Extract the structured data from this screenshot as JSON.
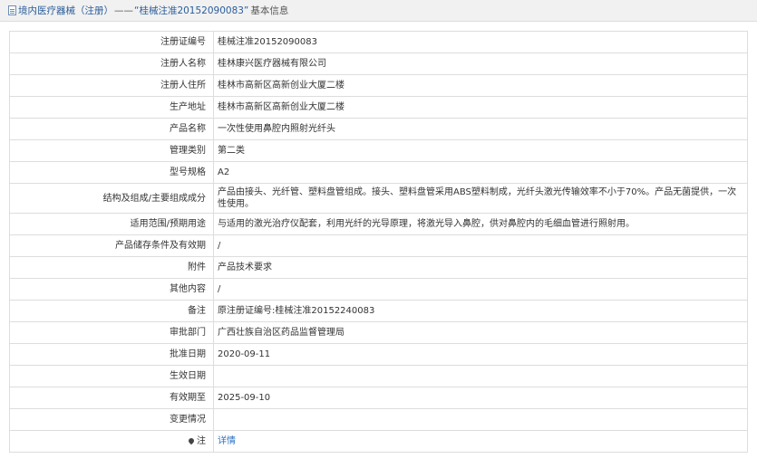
{
  "header": {
    "category": "境内医疗器械（注册）",
    "separator": "——",
    "title": "“桂械注准20152090083”",
    "suffix": "基本信息"
  },
  "rows": [
    {
      "label": "注册证编号",
      "value": "桂械注准20152090083"
    },
    {
      "label": "注册人名称",
      "value": "桂林康兴医疗器械有限公司"
    },
    {
      "label": "注册人住所",
      "value": "桂林市高新区高新创业大厦二楼"
    },
    {
      "label": "生产地址",
      "value": "桂林市高新区高新创业大厦二楼"
    },
    {
      "label": "产品名称",
      "value": "一次性使用鼻腔内照射光纤头"
    },
    {
      "label": "管理类别",
      "value": "第二类"
    },
    {
      "label": "型号规格",
      "value": "A2"
    },
    {
      "label": "结构及组成/主要组成成分",
      "value": "产品由接头、光纤管、塑料盘管组成。接头、塑料盘管采用ABS塑料制成，光纤头激光传输效率不小于70%。产品无菌提供，一次性使用。"
    },
    {
      "label": "适用范围/预期用途",
      "value": "与适用的激光治疗仪配套，利用光纤的光导原理，将激光导入鼻腔，供对鼻腔内的毛细血管进行照射用。"
    },
    {
      "label": "产品储存条件及有效期",
      "value": "/"
    },
    {
      "label": "附件",
      "value": "产品技术要求"
    },
    {
      "label": "其他内容",
      "value": "/"
    },
    {
      "label": "备注",
      "value": "原注册证编号:桂械注准20152240083"
    },
    {
      "label": "审批部门",
      "value": "广西壮族自治区药品监督管理局"
    },
    {
      "label": "批准日期",
      "value": "2020-09-11"
    },
    {
      "label": "生效日期",
      "value": ""
    },
    {
      "label": "有效期至",
      "value": "2025-09-10"
    },
    {
      "label": "变更情况",
      "value": ""
    }
  ],
  "note": {
    "label": "注",
    "icon": "pin-icon",
    "link_text": "详情"
  }
}
